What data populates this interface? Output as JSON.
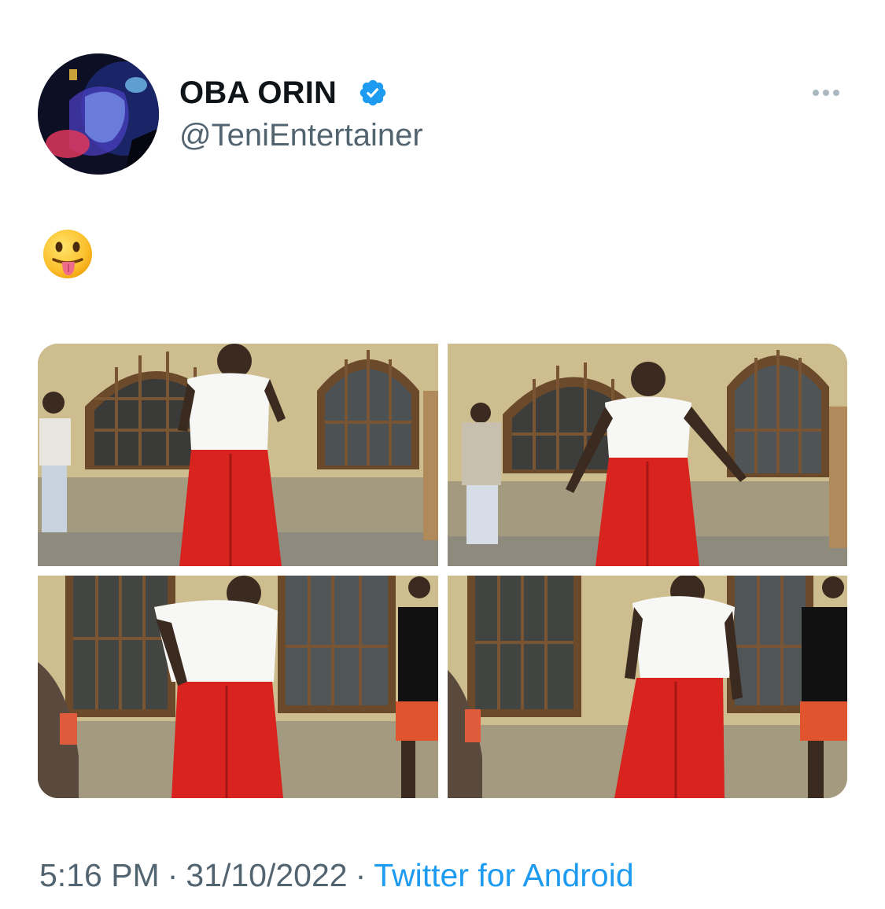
{
  "author": {
    "display_name": "OBA ORIN",
    "handle": "@TeniEntertainer",
    "verified": true,
    "avatar_icon": "profile-avatar",
    "verified_icon": "verified-badge-icon",
    "more_icon": "more-options-icon"
  },
  "tweet": {
    "text": "😛",
    "media_count": 4
  },
  "meta": {
    "time": "5:16 PM",
    "separator": "·",
    "date": "31/10/2022",
    "source": "Twitter for Android"
  },
  "colors": {
    "primary_text": "#0f1419",
    "secondary_text": "#536471",
    "accent": "#1d9bf0",
    "trousers": "#d8231f"
  }
}
